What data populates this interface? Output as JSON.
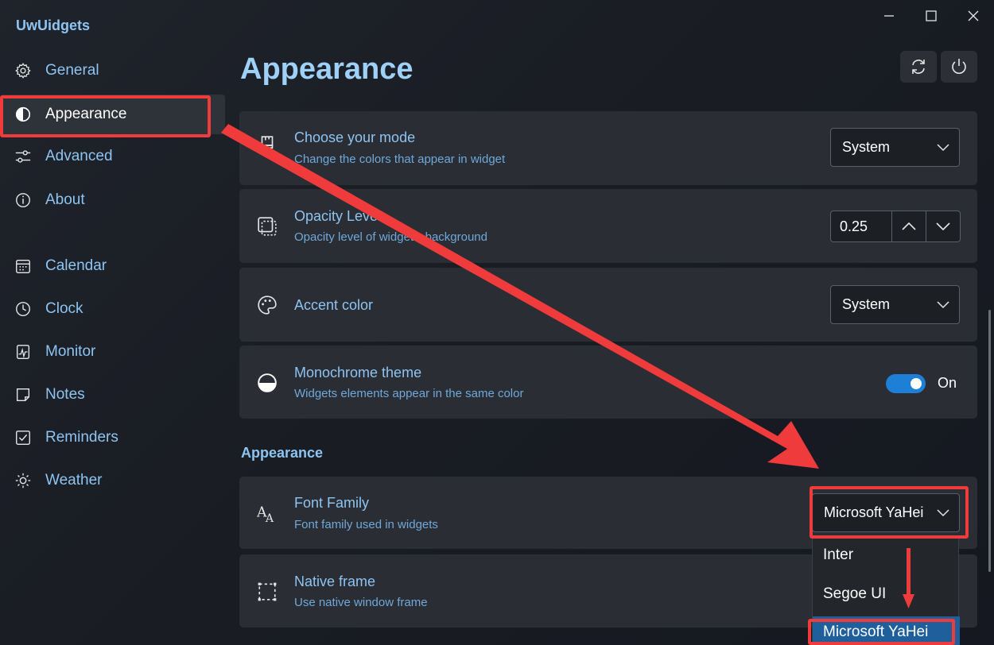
{
  "app": {
    "title": "UwUidgets"
  },
  "window": {
    "minimize_icon": "minimize-icon",
    "maximize_icon": "maximize-icon",
    "close_icon": "close-icon"
  },
  "sidebar": {
    "items": [
      {
        "label": "General",
        "icon": "gear-icon"
      },
      {
        "label": "Appearance",
        "icon": "contrast-icon"
      },
      {
        "label": "Advanced",
        "icon": "sliders-icon"
      },
      {
        "label": "About",
        "icon": "info-icon"
      },
      {
        "label": "Calendar",
        "icon": "calendar-icon"
      },
      {
        "label": "Clock",
        "icon": "clock-icon"
      },
      {
        "label": "Monitor",
        "icon": "monitor-icon"
      },
      {
        "label": "Notes",
        "icon": "note-icon"
      },
      {
        "label": "Reminders",
        "icon": "checkbox-icon"
      },
      {
        "label": "Weather",
        "icon": "sun-icon"
      }
    ],
    "active_item": "Appearance"
  },
  "main": {
    "title": "Appearance",
    "settings": [
      {
        "title": "Choose your mode",
        "subtitle": "Change the colors that appear in widget",
        "control_value": "System"
      },
      {
        "title": "Opacity Level",
        "subtitle": "Opacity level of widget's background",
        "control_value": "0.25"
      },
      {
        "title": "Accent color",
        "control_value": "System"
      },
      {
        "title": "Monochrome theme",
        "subtitle": "Widgets elements appear in the same color",
        "toggle_label": "On",
        "toggle_on": true
      }
    ],
    "section_title": "Appearance",
    "section_settings": [
      {
        "title": "Font Family",
        "subtitle": "Font family used in widgets",
        "control_value": "Microsoft YaHei"
      },
      {
        "title": "Native frame",
        "subtitle": "Use native window frame"
      }
    ],
    "font_options": [
      "Inter",
      "Segoe UI",
      "Microsoft YaHei"
    ],
    "font_selected": "Microsoft YaHei"
  },
  "colors": {
    "accent": "#8dc4f2",
    "toggle_on": "#1e7fd6",
    "annotation": "#ef3b3b",
    "selected_option": "#1f5f9c"
  }
}
